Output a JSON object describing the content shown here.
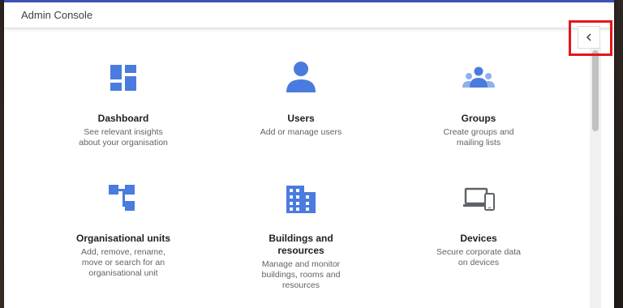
{
  "app": {
    "title": "Admin Console"
  },
  "colors": {
    "accent": "#3f51b5",
    "icon_blue": "#4a7bde",
    "highlight": "#e3161b"
  },
  "collapse_button": {
    "icon": "chevron-left-icon"
  },
  "cards": [
    {
      "icon": "dashboard-icon",
      "title": "Dashboard",
      "desc_lines": [
        "See relevant insights",
        "about your organisation"
      ]
    },
    {
      "icon": "user-icon",
      "title": "Users",
      "desc_lines": [
        "Add or manage users"
      ]
    },
    {
      "icon": "groups-icon",
      "title": "Groups",
      "desc_lines": [
        "Create groups and",
        "mailing lists"
      ]
    },
    {
      "icon": "org-units-icon",
      "title": "Organisational units",
      "desc_lines": [
        "Add, remove, rename,",
        "move or search for an",
        "organisational unit"
      ]
    },
    {
      "icon": "building-icon",
      "title_lines": [
        "Buildings and",
        "resources"
      ],
      "desc_lines": [
        "Manage and monitor",
        "buildings, rooms and",
        "resources"
      ]
    },
    {
      "icon": "devices-icon",
      "title": "Devices",
      "desc_lines": [
        "Secure corporate data",
        "on devices"
      ]
    }
  ]
}
